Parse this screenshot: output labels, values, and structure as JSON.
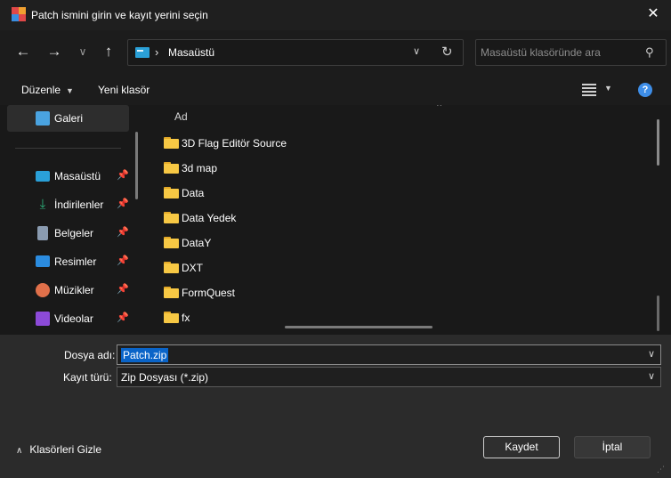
{
  "window": {
    "title": "Patch ismini girin ve kayıt yerini seçin",
    "close_glyph": "✕"
  },
  "nav": {
    "back": "←",
    "forward": "→",
    "recent": "∨",
    "up": "↑"
  },
  "address": {
    "separator": "›",
    "location": "Masaüstü",
    "chevron": "∨",
    "refresh": "↻"
  },
  "search": {
    "placeholder": "Masaüstü klasöründe ara",
    "icon": "⚲"
  },
  "toolbar": {
    "organize": "Düzenle",
    "new_folder": "Yeni klasör",
    "help": "?"
  },
  "sidebar": {
    "top": {
      "label": "Galeri",
      "icon": "gallery-icon",
      "color": "#4aa3e0"
    },
    "items": [
      {
        "label": "Masaüstü",
        "icon": "desktop-icon",
        "color": "#2aa0d8"
      },
      {
        "label": "İndirilenler",
        "icon": "download-icon",
        "color": "#2db07a"
      },
      {
        "label": "Belgeler",
        "icon": "documents-icon",
        "color": "#8a9bb0"
      },
      {
        "label": "Resimler",
        "icon": "pictures-icon",
        "color": "#2b8ce0"
      },
      {
        "label": "Müzikler",
        "icon": "music-icon",
        "color": "#e0704a"
      },
      {
        "label": "Videolar",
        "icon": "videos-icon",
        "color": "#8c4ad8"
      }
    ],
    "pin_glyph": "📌"
  },
  "files": {
    "column": "Ad",
    "sort_glyph": "⌃",
    "items": [
      "3D Flag Editör Source",
      "3d map",
      "Data",
      "Data Yedek",
      "DataY",
      "DXT",
      "FormQuest",
      "fx"
    ]
  },
  "form": {
    "filename_label": "Dosya adı:",
    "filename_value": "Patch.zip",
    "type_label": "Kayıt türü:",
    "type_value": "Zip Dosyası (*.zip)",
    "chevron": "∨"
  },
  "footer": {
    "hide_folders": "Klasörleri Gizle",
    "caret": "∧",
    "save": "Kaydet",
    "cancel": "İptal"
  },
  "colors": {
    "accent": "#0a64c8",
    "folder": "#f7c844",
    "help": "#3e8ee8"
  }
}
